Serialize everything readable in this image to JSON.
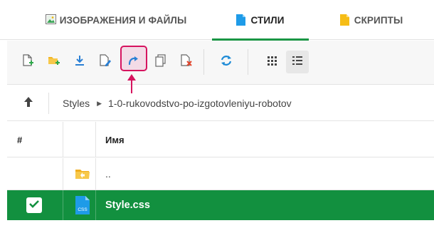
{
  "tabs": [
    {
      "label": "ИЗОБРАЖЕНИЯ И ФАЙЛЫ",
      "icon": "image-icon"
    },
    {
      "label": "СТИЛИ",
      "icon": "blue-file-icon",
      "active": true
    },
    {
      "label": "СКРИПТЫ",
      "icon": "yellow-file-icon"
    }
  ],
  "toolbar": {
    "buttons": [
      {
        "name": "new-file-button",
        "icon": "new-file-icon"
      },
      {
        "name": "new-folder-button",
        "icon": "new-folder-icon"
      },
      {
        "name": "download-button",
        "icon": "download-icon"
      },
      {
        "name": "edit-button",
        "icon": "edit-icon"
      },
      {
        "name": "redo-button",
        "icon": "redo-icon",
        "highlighted": true
      },
      {
        "name": "copy-button",
        "icon": "copy-icon"
      },
      {
        "name": "delete-button",
        "icon": "delete-file-icon"
      },
      {
        "name": "refresh-button",
        "icon": "refresh-icon"
      },
      {
        "name": "grid-view-button",
        "icon": "grid-icon"
      },
      {
        "name": "list-view-button",
        "icon": "list-icon",
        "active": true
      }
    ],
    "highlight_color": "#d6145f"
  },
  "path": {
    "crumbs": [
      "Styles",
      "1-0-rukovodstvo-po-izgotovleniyu-robotov"
    ],
    "separator": "▶"
  },
  "table": {
    "headers": {
      "hash": "#",
      "name": "Имя"
    },
    "rows": [
      {
        "name": "..",
        "icon": "parent-folder-icon",
        "selected": false
      },
      {
        "name": "Style.css",
        "icon": "css-file-icon",
        "selected": true,
        "icon_label": "CSS"
      }
    ]
  },
  "colors": {
    "accent_green": "#12903f",
    "tab_underline": "#1a9645",
    "highlight": "#d6145f"
  }
}
